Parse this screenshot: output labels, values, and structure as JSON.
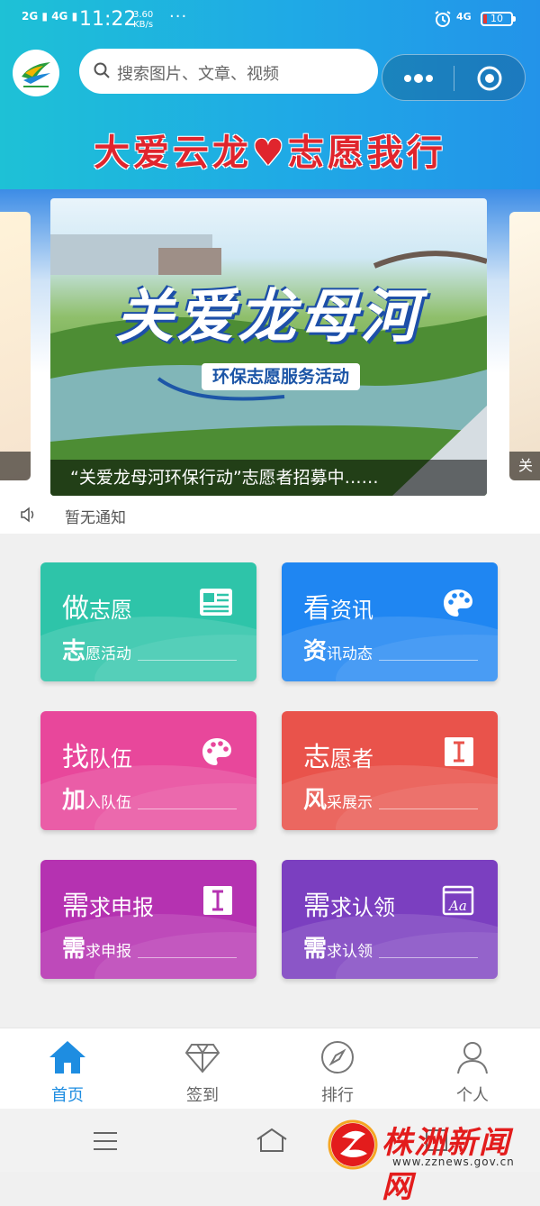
{
  "status_bar": {
    "network_1": "2G",
    "network_2": "4G",
    "time": "11:22",
    "speed_value": "3.60",
    "speed_unit": "KB/s",
    "dots": "···",
    "network_right": "4G",
    "battery": "10"
  },
  "header": {
    "search_placeholder": "搜索图片、文章、视频",
    "slogan": "大爱云龙♥志愿我行"
  },
  "banner": {
    "title": "关爱龙母河",
    "subtitle": "环保志愿服务活动",
    "caption": "“关爱龙母河环保行动”志愿者招募中……",
    "right_peek_caption": "关"
  },
  "notice": {
    "text": "暂无通知"
  },
  "tiles": [
    {
      "title_first": "做",
      "title_rest": "志愿",
      "sub_first": "志",
      "sub_rest": "愿活动",
      "color": "#2ec4a9",
      "icon": "news-card-icon"
    },
    {
      "title_first": "看",
      "title_rest": "资讯",
      "sub_first": "资",
      "sub_rest": "讯动态",
      "color": "#1f86f2",
      "icon": "palette-icon"
    },
    {
      "title_first": "找",
      "title_rest": "队伍",
      "sub_first": "加",
      "sub_rest": "入队伍",
      "color": "#e8479b",
      "icon": "palette-icon"
    },
    {
      "title_first": "志",
      "title_rest": "愿者",
      "sub_first": "风",
      "sub_rest": "采展示",
      "color": "#e9534b",
      "icon": "text-cursor-icon"
    },
    {
      "title_first": "需",
      "title_rest": "求申报",
      "sub_first": "需",
      "sub_rest": "求申报",
      "color": "#b532b1",
      "icon": "text-cursor-icon"
    },
    {
      "title_first": "需",
      "title_rest": "求认领",
      "sub_first": "需",
      "sub_rest": "求认领",
      "color": "#7b3fc0",
      "icon": "font-aa-icon"
    }
  ],
  "tabbar": {
    "items": [
      {
        "label": "首页",
        "icon": "home-icon",
        "active": true
      },
      {
        "label": "签到",
        "icon": "diamond-icon"
      },
      {
        "label": "排行",
        "icon": "compass-icon"
      },
      {
        "label": "个人",
        "icon": "user-icon"
      }
    ]
  },
  "watermark": {
    "text": "株洲新闻网",
    "url": "www.zznews.gov.cn"
  },
  "colors": {
    "header_start": "#1ec1d6",
    "header_end": "#2393e9",
    "active_tab": "#1e8de1",
    "slogan": "#e0252d"
  }
}
